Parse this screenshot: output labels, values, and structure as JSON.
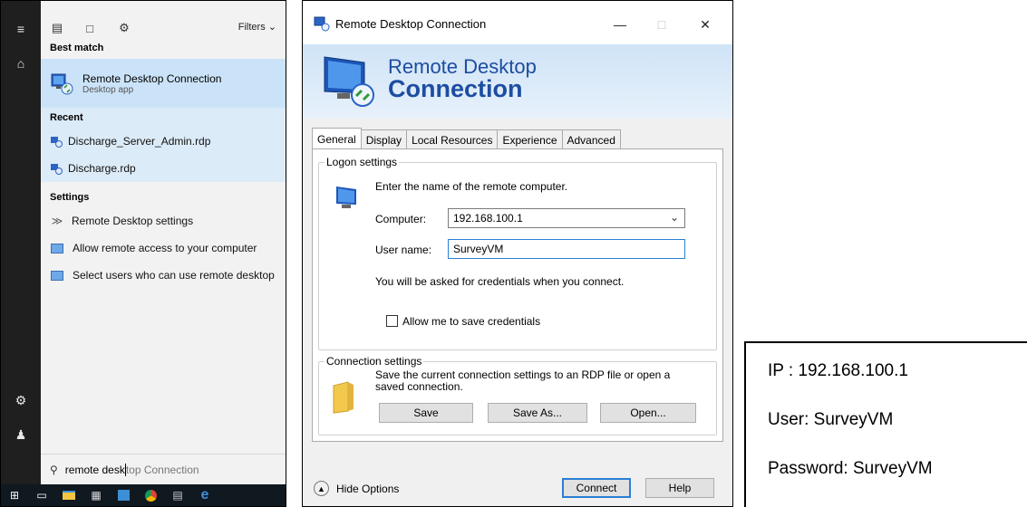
{
  "start_menu": {
    "filters_label": "Filters",
    "best_match_label": "Best match",
    "best_match": {
      "title": "Remote Desktop Connection",
      "subtitle": "Desktop app"
    },
    "recent_label": "Recent",
    "recent_items": [
      "Discharge_Server_Admin.rdp",
      "Discharge.rdp"
    ],
    "settings_label": "Settings",
    "settings_items": [
      {
        "icon": "remote-desktop-settings-icon",
        "text": "Remote Desktop settings"
      },
      {
        "icon": "monitor-icon",
        "text": "Allow remote access to your computer"
      },
      {
        "icon": "monitor-icon",
        "text": "Select users who can use remote desktop"
      }
    ],
    "search": {
      "typed": "remote desk",
      "suggestion": "top Connection"
    }
  },
  "dialog": {
    "title": "Remote Desktop Connection",
    "banner_line1": "Remote Desktop",
    "banner_line2": "Connection",
    "tabs": [
      "General",
      "Display",
      "Local Resources",
      "Experience",
      "Advanced"
    ],
    "active_tab": "General",
    "logon": {
      "group_title": "Logon settings",
      "instruction": "Enter the name of the remote computer.",
      "computer_label": "Computer:",
      "computer_value": "192.168.100.1",
      "username_label": "User name:",
      "username_value": "SurveyVM",
      "credentials_note": "You will be asked for credentials when you connect.",
      "save_credentials_label": "Allow me to save credentials",
      "save_credentials_checked": false
    },
    "connection": {
      "group_title": "Connection settings",
      "description": "Save the current connection settings to an RDP file or open a saved connection.",
      "save_button": "Save",
      "save_as_button": "Save As...",
      "open_button": "Open..."
    },
    "hide_options": "Hide Options",
    "connect_button": "Connect",
    "help_button": "Help"
  },
  "info": {
    "ip": "IP : 192.168.100.1",
    "user": "User: SurveyVM",
    "password": "Password: SurveyVM"
  },
  "colors": {
    "accent": "#1c4da1",
    "selection": "#cbe3f8",
    "taskbar": "#101820"
  }
}
